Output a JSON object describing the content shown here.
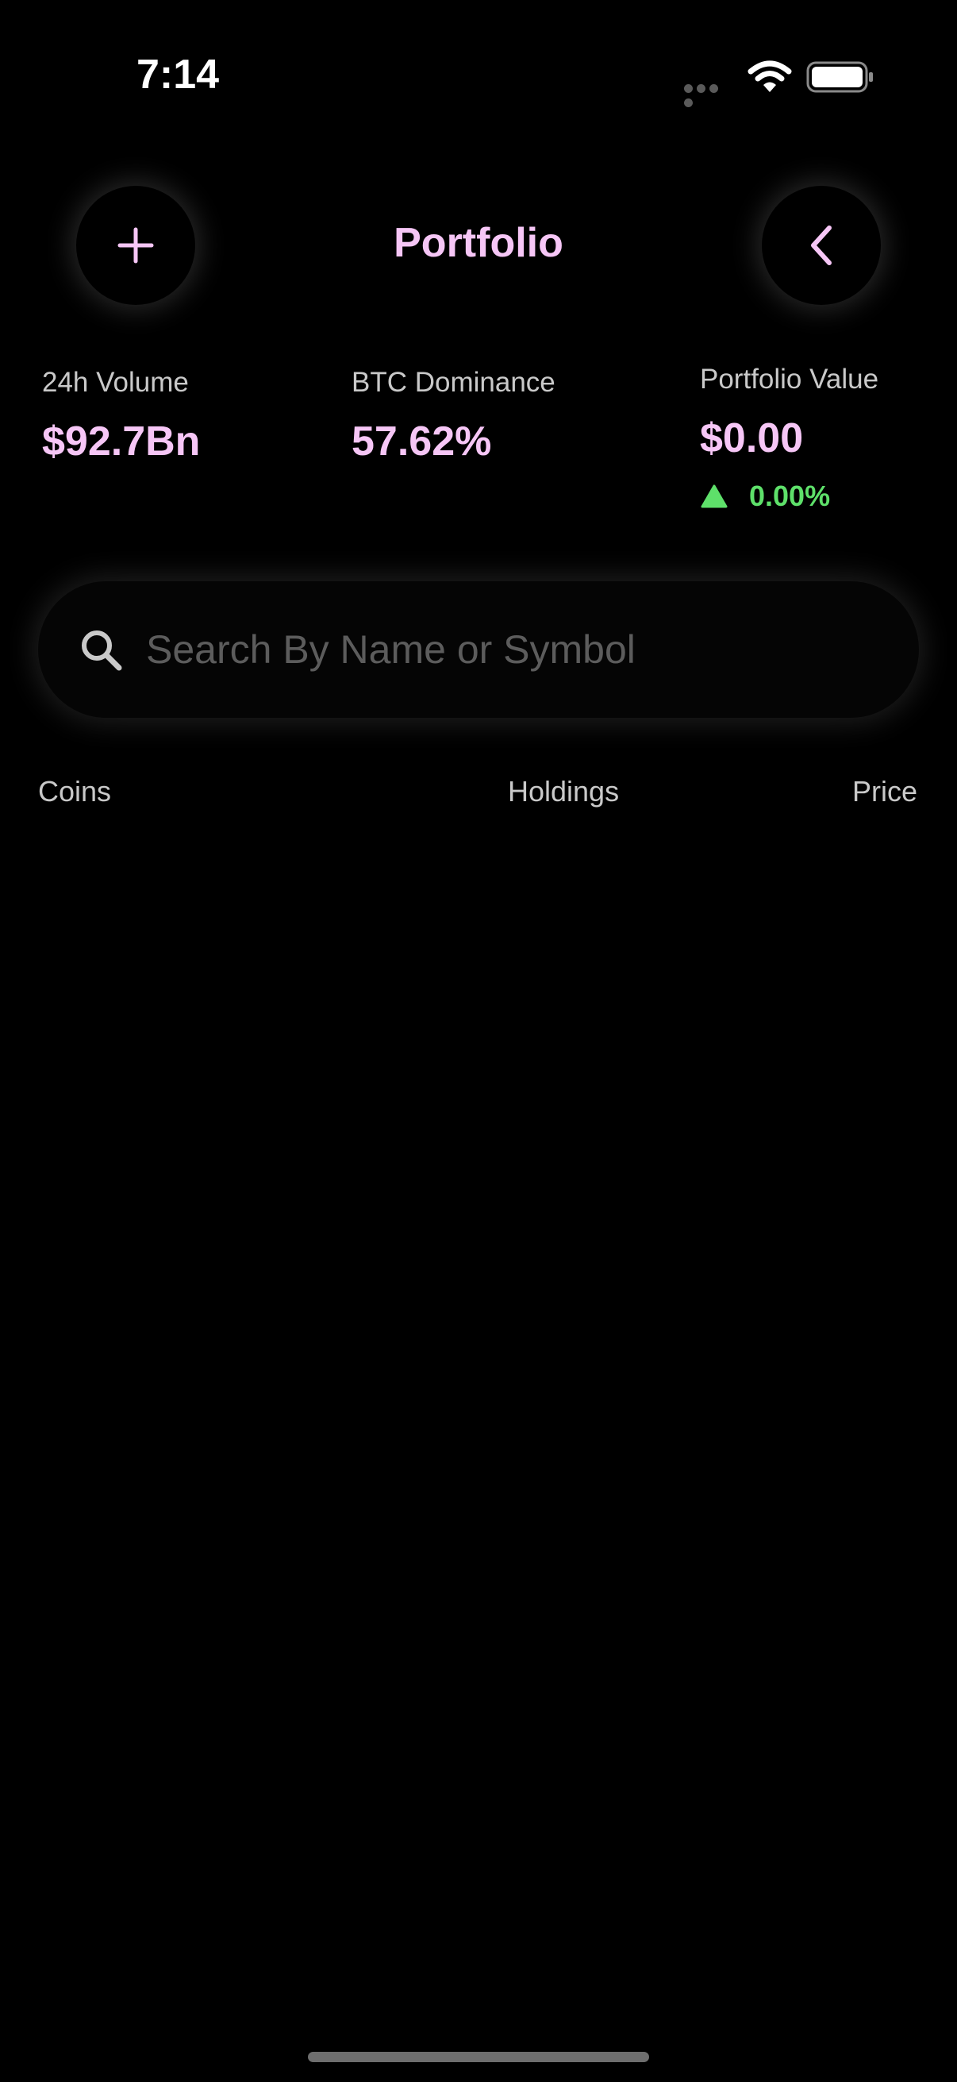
{
  "status_bar": {
    "time": "7:14",
    "icons": [
      "signal-dots-icon",
      "wifi-icon",
      "battery-icon"
    ]
  },
  "header": {
    "title": "Portfolio",
    "left_button_icon": "plus-icon",
    "right_button_icon": "chevron-left-icon"
  },
  "stats": [
    {
      "label": "24h Volume",
      "value": "$92.7Bn"
    },
    {
      "label": "BTC Dominance",
      "value": "57.62%"
    },
    {
      "label": "Portfolio Value",
      "value": "$0.00",
      "change": "0.00%",
      "change_direction": "up"
    }
  ],
  "search": {
    "placeholder": "Search By Name or Symbol",
    "value": "",
    "icon": "search-icon"
  },
  "columns": {
    "coins": "Coins",
    "holdings": "Holdings",
    "price": "Price"
  },
  "colors": {
    "background": "#000000",
    "accent": "#f6c6f6",
    "positive": "#5ee06a",
    "label": "#c9c9c9",
    "placeholder": "#5c5c5c"
  }
}
